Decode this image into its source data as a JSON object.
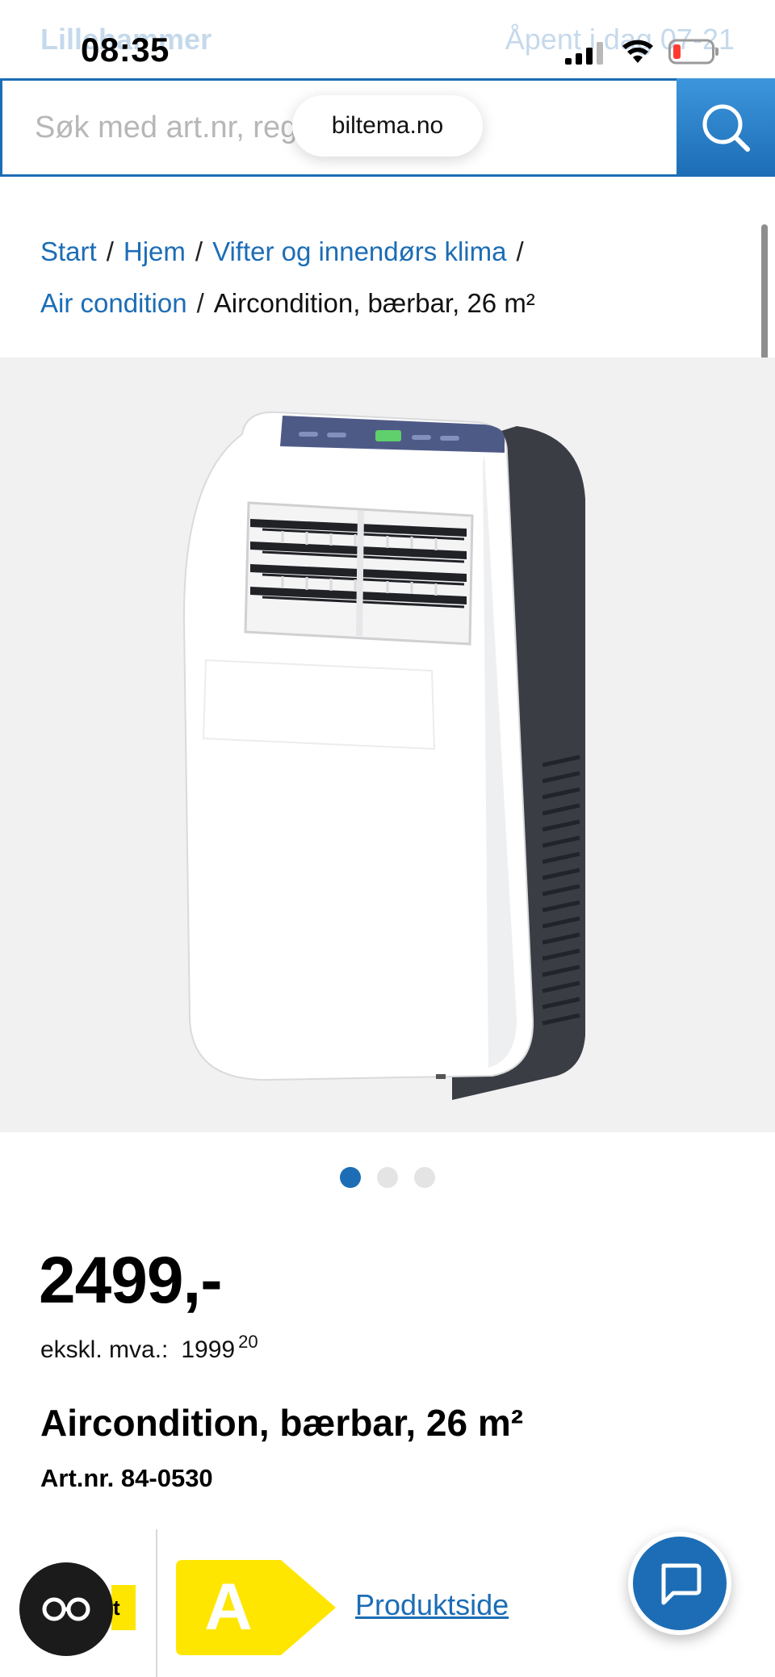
{
  "status_bar": {
    "time": "08:35",
    "store_name": "Lillehammer",
    "store_hours": "Åpent i dag 07-21",
    "icons": [
      "signal-icon",
      "wifi-icon",
      "battery-low-icon"
    ]
  },
  "search": {
    "placeholder": "Søk med art.nr, reg.nr eller tekst",
    "url": "biltema.no",
    "icon": "search-icon"
  },
  "breadcrumb": {
    "items": [
      "Start",
      "Hjem",
      "Vifter og innendørs klima",
      "Air condition"
    ],
    "separator": "/",
    "current": "Aircondition, bærbar, 26 m²"
  },
  "gallery": {
    "image_alt": "Aircondition, bærbar, 26 m²",
    "total_images": 3,
    "active_index": 1
  },
  "product": {
    "price": "2499,-",
    "vat_label": "ekskl. mva.:",
    "vat_price_main": "1999",
    "vat_price_decimals": "20",
    "title": "Aircondition, bærbar, 26 m²",
    "art_nr": "Art.nr. 84-0530",
    "energy_class": "A",
    "product_sheet_link": "Produktside",
    "partial_label": "t"
  },
  "colors": {
    "brand_blue": "#1c6db5",
    "energy_yellow": "#ffe600",
    "image_bg": "#f1f1f2"
  }
}
